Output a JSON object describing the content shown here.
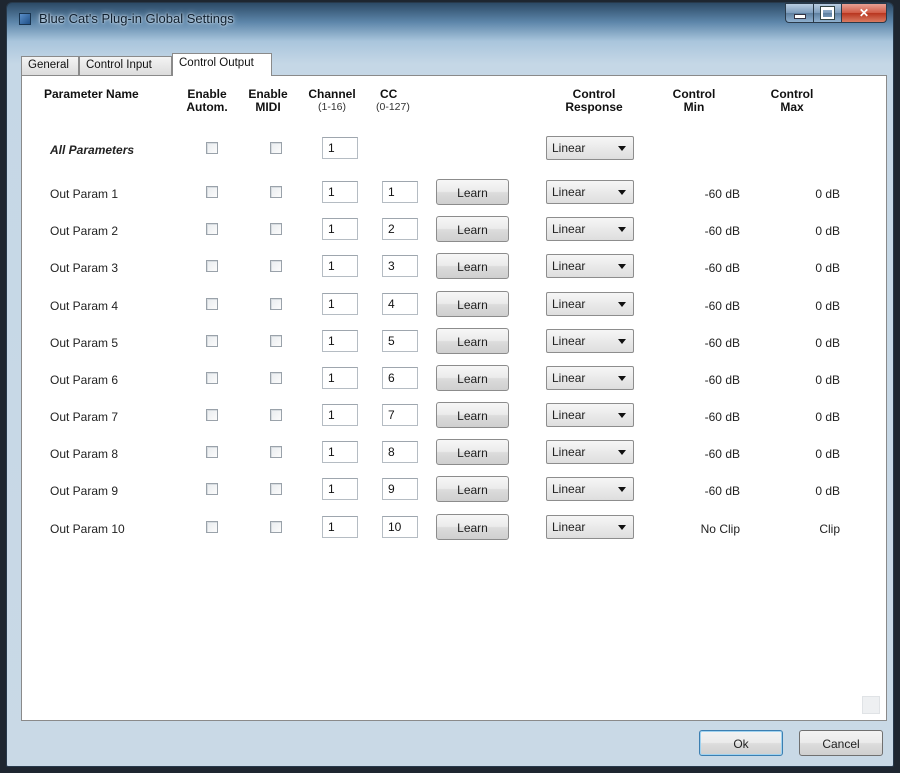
{
  "window": {
    "title": "Blue Cat's Plug-in Global Settings"
  },
  "tabs": [
    {
      "label": "General",
      "active": false
    },
    {
      "label": "Control Input",
      "active": false
    },
    {
      "label": "Control Output",
      "active": true
    }
  ],
  "headers": {
    "parameter_name": "Parameter Name",
    "enable_autom": [
      "Enable",
      "Autom."
    ],
    "enable_midi": [
      "Enable",
      "MIDI"
    ],
    "channel": [
      "Channel",
      "(1-16)"
    ],
    "cc": [
      "CC",
      "(0-127)"
    ],
    "control_response": [
      "Control",
      "Response"
    ],
    "control_min": [
      "Control",
      "Min"
    ],
    "control_max": [
      "Control",
      "Max"
    ]
  },
  "all_parameters": {
    "name": "All Parameters",
    "channel": "1",
    "response": "Linear"
  },
  "learn_label": "Learn",
  "rows": [
    {
      "name": "Out Param 1",
      "channel": "1",
      "cc": "1",
      "response": "Linear",
      "min": "-60 dB",
      "max": "0 dB"
    },
    {
      "name": "Out Param 2",
      "channel": "1",
      "cc": "2",
      "response": "Linear",
      "min": "-60 dB",
      "max": "0 dB"
    },
    {
      "name": "Out Param 3",
      "channel": "1",
      "cc": "3",
      "response": "Linear",
      "min": "-60 dB",
      "max": "0 dB"
    },
    {
      "name": "Out Param 4",
      "channel": "1",
      "cc": "4",
      "response": "Linear",
      "min": "-60 dB",
      "max": "0 dB"
    },
    {
      "name": "Out Param 5",
      "channel": "1",
      "cc": "5",
      "response": "Linear",
      "min": "-60 dB",
      "max": "0 dB"
    },
    {
      "name": "Out Param 6",
      "channel": "1",
      "cc": "6",
      "response": "Linear",
      "min": "-60 dB",
      "max": "0 dB"
    },
    {
      "name": "Out Param 7",
      "channel": "1",
      "cc": "7",
      "response": "Linear",
      "min": "-60 dB",
      "max": "0 dB"
    },
    {
      "name": "Out Param 8",
      "channel": "1",
      "cc": "8",
      "response": "Linear",
      "min": "-60 dB",
      "max": "0 dB"
    },
    {
      "name": "Out Param 9",
      "channel": "1",
      "cc": "9",
      "response": "Linear",
      "min": "-60 dB",
      "max": "0 dB"
    },
    {
      "name": "Out Param 10",
      "channel": "1",
      "cc": "10",
      "response": "Linear",
      "min": "No Clip",
      "max": "Clip"
    }
  ],
  "footer": {
    "ok_label": "Ok",
    "cancel_label": "Cancel"
  },
  "icons": [
    "app-icon",
    "minimize-icon",
    "maximize-icon",
    "close-icon",
    "dropdown-arrow-icon",
    "resize-grip-icon"
  ]
}
